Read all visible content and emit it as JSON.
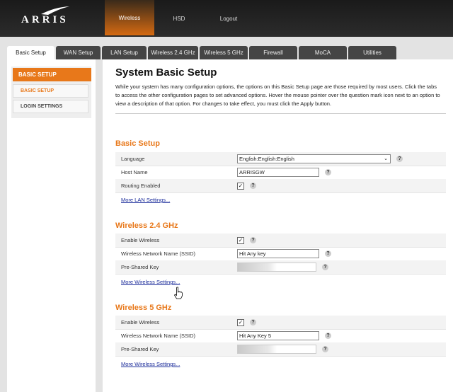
{
  "brand": {
    "logo_text": "ARRIS"
  },
  "topnav": {
    "items": [
      "Wireless",
      "HSD",
      "Logout"
    ],
    "active": "Wireless"
  },
  "tabs": [
    "Basic Setup",
    "WAN Setup",
    "LAN Setup",
    "Wireless 2.4 GHz",
    "Wireless 5 GHz",
    "Firewall",
    "MoCA",
    "Utilities"
  ],
  "sidebar": {
    "header": "BASIC SETUP",
    "items": [
      "BASIC SETUP",
      "LOGIN SETTINGS"
    ]
  },
  "page": {
    "title": "System Basic Setup",
    "intro": "While your system has many configuration options, the options on this Basic Setup page are those required by most users. Click the tabs to access the other configuration pages to set advanced options. Hover the mouse pointer over the question mark icon next to an option to view a description of that option. For changes to take effect, you must click the Apply button."
  },
  "basic_setup": {
    "title": "Basic Setup",
    "language_label": "Language",
    "language_value": "English:English:English",
    "host_label": "Host Name",
    "host_value": "ARRISGW",
    "routing_label": "Routing Enabled",
    "routing_checked": true,
    "more_link": "More LAN Settings..."
  },
  "wireless24": {
    "title": "Wireless 2.4 GHz",
    "enable_label": "Enable Wireless",
    "enable_checked": true,
    "ssid_label": "Wireless Network Name (SSID)",
    "ssid_value": "Hit Any key",
    "psk_label": "Pre-Shared Key",
    "more_link": "More Wireless Settings..."
  },
  "wireless5": {
    "title": "Wireless 5 GHz",
    "enable_label": "Enable Wireless",
    "enable_checked": true,
    "ssid_label": "Wireless Network Name (SSID)",
    "ssid_value": "Hit Any Key 5",
    "psk_label": "Pre-Shared Key",
    "more_link": "More Wireless Settings..."
  },
  "help_glyph": "?",
  "check_glyph": "✓",
  "select_arrow": "⌄",
  "colors": {
    "accent": "#e8781a",
    "link": "#1a2b9a",
    "header_bg": "#1a1a1a",
    "tab_bg": "#454545"
  }
}
